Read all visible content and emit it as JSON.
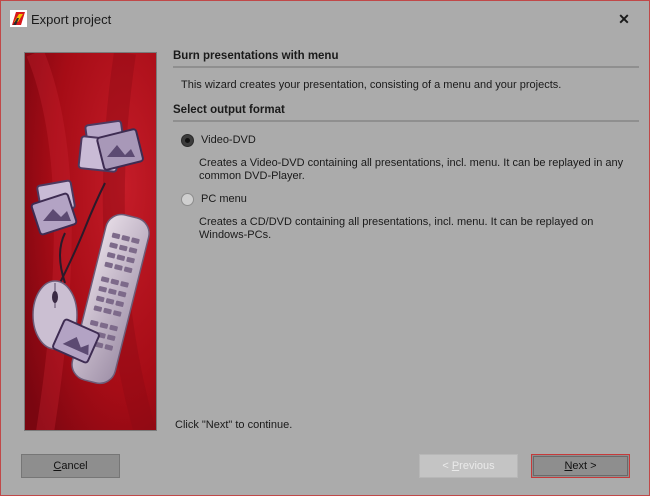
{
  "window": {
    "title": "Export project",
    "close_glyph": "✕",
    "icon": "app-logo-icon"
  },
  "sidebar_image": {
    "description_icons": [
      "photo-stack-icon",
      "remote-control-icon",
      "mouse-icon"
    ]
  },
  "section1": {
    "header": "Burn presentations with menu",
    "intro": "This wizard creates your presentation, consisting of a menu and your projects."
  },
  "section2": {
    "header": "Select output format",
    "options": [
      {
        "label": "Video-DVD",
        "selected": true,
        "description": "Creates a Video-DVD containing all presentations, incl. menu. It can be replayed in any common DVD-Player."
      },
      {
        "label": "PC menu",
        "selected": false,
        "description": "Creates a CD/DVD containing all presentations, incl. menu. It can be replayed on Windows-PCs."
      }
    ]
  },
  "hint": "Click \"Next\" to continue.",
  "buttons": {
    "cancel_first": "C",
    "cancel_rest": "ancel",
    "prev_before": "< ",
    "prev_u": "P",
    "prev_rest": "revious",
    "next_u": "N",
    "next_rest": "ext >"
  },
  "colors": {
    "window_bg": "#ababab",
    "border_accent": "#c63a3a",
    "image_red": "#b00c18"
  }
}
